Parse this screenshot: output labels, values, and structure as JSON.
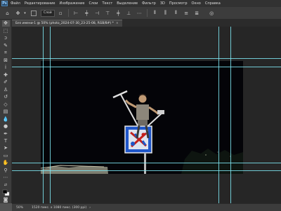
{
  "menubar": {
    "logo": "Ps",
    "items": [
      "Файл",
      "Редактирование",
      "Изображение",
      "Слои",
      "Текст",
      "Выделение",
      "Фильтр",
      "3D",
      "Просмотр",
      "Окно",
      "Справка"
    ]
  },
  "options": {
    "layer_select": "Слой"
  },
  "document_tab": {
    "title": "Без имени-1 @ 50% (photo_2024-07-30_23-25-08, RGB/8#) *",
    "close": "×"
  },
  "status": {
    "zoom": "50%",
    "info": "1520 пикс. x 1080 пикс. (300 ppi)"
  },
  "colors": {
    "accent_guides": "#7fe8f3",
    "workspace": "#262626",
    "panel": "#3c3c3c"
  }
}
